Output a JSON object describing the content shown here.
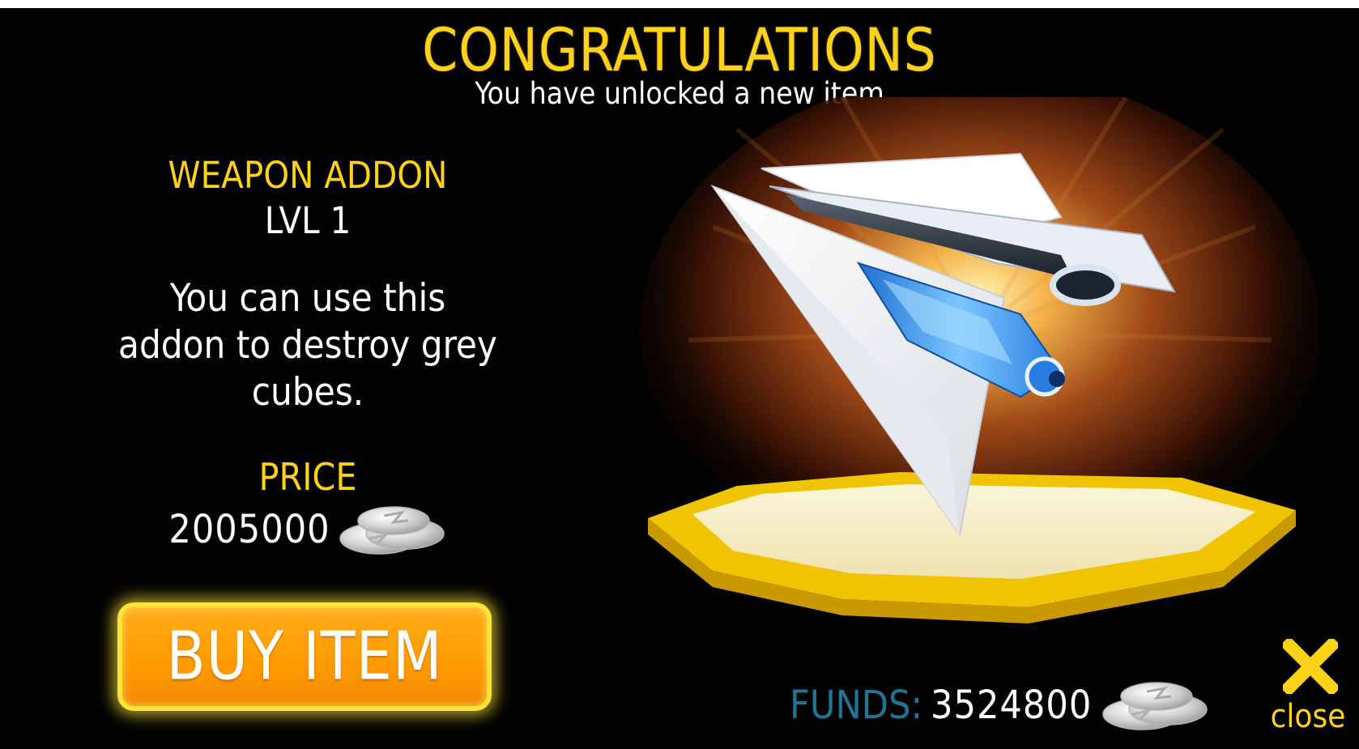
{
  "header": {
    "title": "CONGRATULATIONS",
    "subtitle": "You have unlocked a new item"
  },
  "item": {
    "type": "WEAPON ADDON",
    "level": "LVL 1",
    "description": "You can use this addon to destroy grey cubes.",
    "price_label": "PRICE",
    "price_value": "2005000",
    "currency_icon": "silver-coins-icon"
  },
  "actions": {
    "buy_label": "BUY ITEM",
    "close_label": "close",
    "close_icon": "close-x-icon"
  },
  "funds": {
    "label": "FUNDS:",
    "value": "3524800"
  },
  "colors": {
    "accent_yellow": "#ffd21a",
    "button_orange": "#ff9a00",
    "funds_blue": "#1f7696",
    "background": "#020202"
  }
}
